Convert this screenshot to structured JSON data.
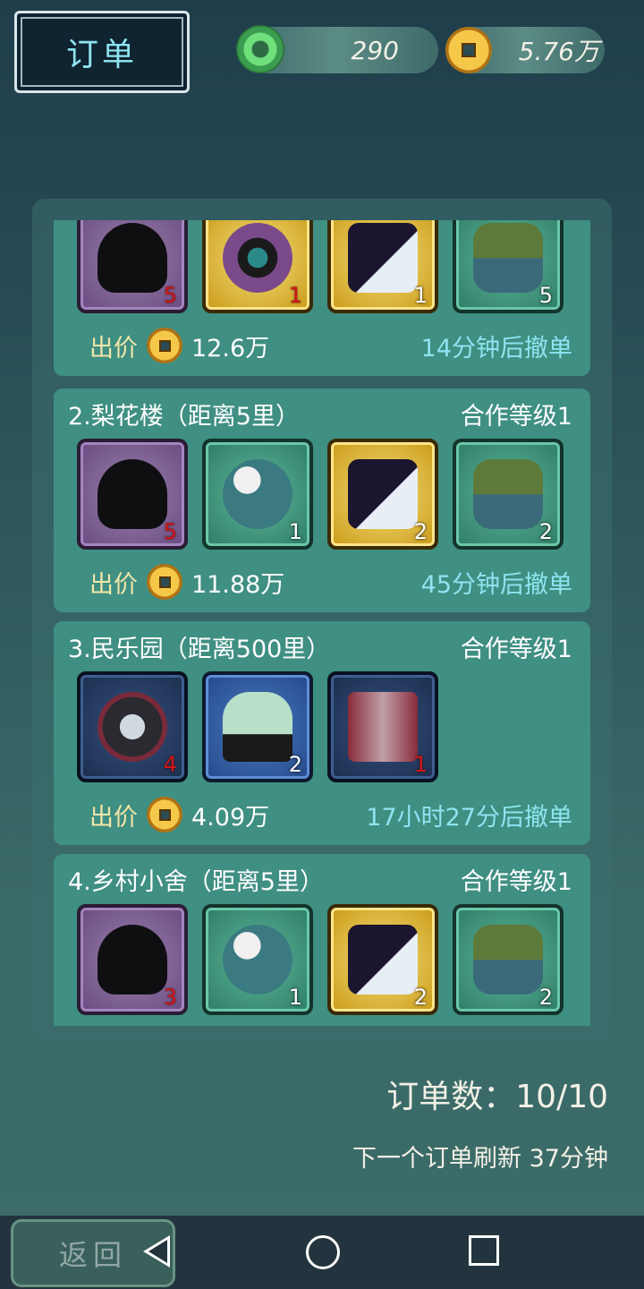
{
  "header": {
    "title": "订单"
  },
  "resources": {
    "jade": "290",
    "coins": "5.76万"
  },
  "orders": [
    {
      "title": "",
      "level": "",
      "items": [
        {
          "icon": "black-hat-icon",
          "rarity": "purple",
          "qty": "5",
          "qty_red": true
        },
        {
          "icon": "phoenix-crown-icon",
          "rarity": "gold",
          "qty": "1",
          "qty_red": true
        },
        {
          "icon": "opera-robe-icon",
          "rarity": "gold",
          "qty": "1",
          "qty_red": false
        },
        {
          "icon": "straw-cape-icon",
          "rarity": "green",
          "qty": "5",
          "qty_red": false
        }
      ],
      "offer_label": "出价",
      "offer_amount": "12.6万",
      "withdraw": "14分钟后撤单"
    },
    {
      "title": "2.梨花楼（距离5里）",
      "level": "合作等级1",
      "items": [
        {
          "icon": "black-hat-icon",
          "rarity": "purple",
          "qty": "5",
          "qty_red": true
        },
        {
          "icon": "teal-cap-icon",
          "rarity": "green",
          "qty": "1",
          "qty_red": false
        },
        {
          "icon": "opera-robe-icon",
          "rarity": "gold",
          "qty": "2",
          "qty_red": false
        },
        {
          "icon": "straw-cape-icon",
          "rarity": "green",
          "qty": "2",
          "qty_red": false
        }
      ],
      "offer_label": "出价",
      "offer_amount": "11.88万",
      "withdraw": "45分钟后撤单"
    },
    {
      "title": "3.民乐园（距离500里）",
      "level": "合作等级1",
      "items": [
        {
          "icon": "feather-fan-headdress-icon",
          "rarity": "darkblue",
          "qty": "4",
          "qty_red": true
        },
        {
          "icon": "veiled-hat-icon",
          "rarity": "blue",
          "qty": "2",
          "qty_red": false
        },
        {
          "icon": "red-gown-icon",
          "rarity": "darkblue",
          "qty": "1",
          "qty_red": true
        }
      ],
      "offer_label": "出价",
      "offer_amount": "4.09万",
      "withdraw": "17小时27分后撤单"
    },
    {
      "title": "4.乡村小舍（距离5里）",
      "level": "合作等级1",
      "items": [
        {
          "icon": "black-hat-icon",
          "rarity": "purple",
          "qty": "3",
          "qty_red": true
        },
        {
          "icon": "teal-cap-icon",
          "rarity": "green",
          "qty": "1",
          "qty_red": false
        },
        {
          "icon": "opera-robe-icon",
          "rarity": "gold",
          "qty": "2",
          "qty_red": false
        },
        {
          "icon": "straw-cape-icon",
          "rarity": "green",
          "qty": "2",
          "qty_red": false
        }
      ],
      "offer_label": "",
      "offer_amount": "",
      "withdraw": ""
    }
  ],
  "footer": {
    "order_count": "订单数：10/10",
    "refresh": "下一个订单刷新 37分钟",
    "back_label": "返回"
  }
}
